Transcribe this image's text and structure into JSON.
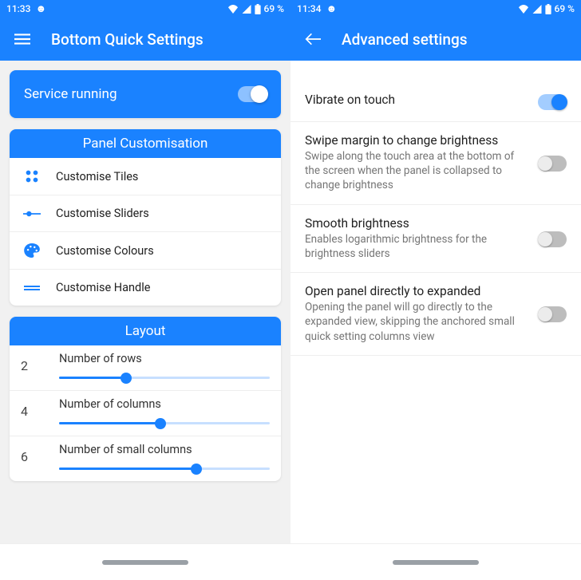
{
  "left": {
    "status": {
      "time": "11:33",
      "battery": "69 %"
    },
    "app_title": "Bottom Quick Settings",
    "service": {
      "label": "Service running",
      "on": true
    },
    "panel_header": "Panel Customisation",
    "panel_items": [
      {
        "icon": "tiles-icon",
        "label": "Customise Tiles"
      },
      {
        "icon": "sliders-icon",
        "label": "Customise Sliders"
      },
      {
        "icon": "palette-icon",
        "label": "Customise Colours"
      },
      {
        "icon": "handle-icon",
        "label": "Customise Handle"
      }
    ],
    "layout_header": "Layout",
    "layout_rows": [
      {
        "label": "Number of rows",
        "value": "2",
        "pct": 32
      },
      {
        "label": "Number of columns",
        "value": "4",
        "pct": 48
      },
      {
        "label": "Number of small columns",
        "value": "6",
        "pct": 65
      }
    ]
  },
  "right": {
    "status": {
      "time": "11:34",
      "battery": "69 %"
    },
    "app_title": "Advanced settings",
    "settings": [
      {
        "title": "Vibrate on touch",
        "sub": "",
        "on": true
      },
      {
        "title": "Swipe margin to change brightness",
        "sub": "Swipe along the touch area at the bottom of the screen when the panel is collapsed to change brightness",
        "on": false
      },
      {
        "title": "Smooth brightness",
        "sub": "Enables logarithmic brightness for the brightness sliders",
        "on": false
      },
      {
        "title": "Open panel directly to expanded",
        "sub": "Opening the panel will go directly to the expanded view, skipping the anchored small quick setting columns view",
        "on": false
      }
    ]
  }
}
